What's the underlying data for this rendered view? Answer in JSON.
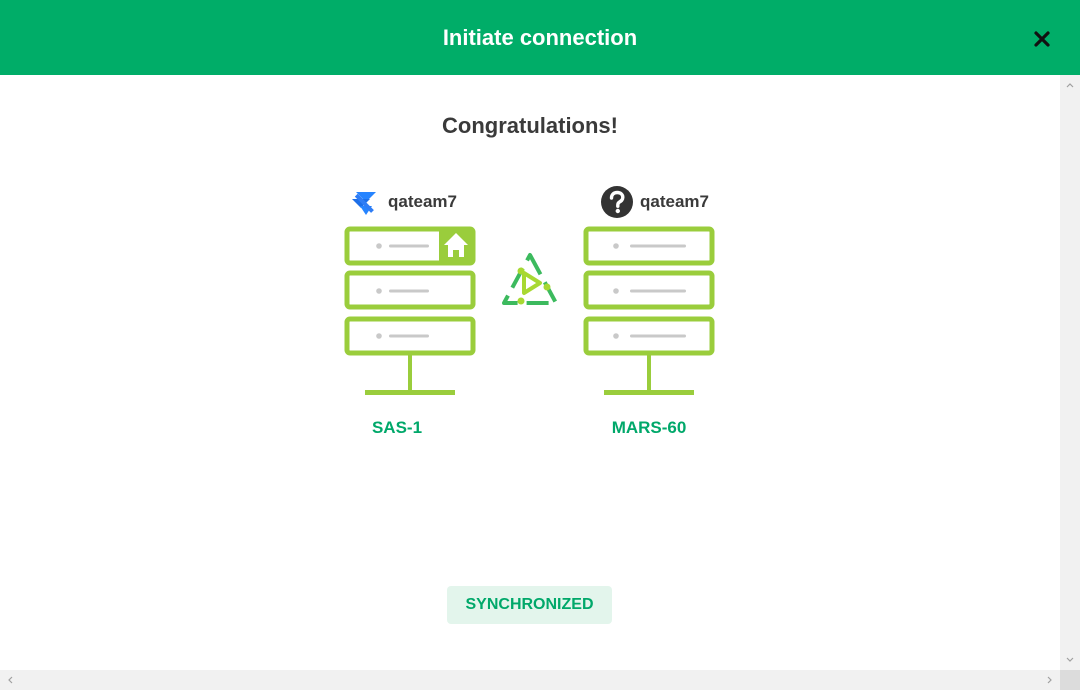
{
  "header": {
    "title": "Initiate connection",
    "close_icon": "close-icon"
  },
  "main": {
    "heading": "Congratulations!",
    "left": {
      "user": "qateam7",
      "user_icon": "jira-logo-icon",
      "server": "SAS-1",
      "server_icon": "server-home-icon"
    },
    "right": {
      "user": "qateam7",
      "user_icon": "question-mark-icon",
      "server": "MARS-60",
      "server_icon": "server-icon"
    },
    "connector_icon": "sync-triangle-icon",
    "status": "SYNCHRONIZED"
  },
  "colors": {
    "header_bg": "#00ad68",
    "server_green": "#9acd3c",
    "server_name": "#00a86a",
    "badge_bg": "#e3f5ec"
  }
}
